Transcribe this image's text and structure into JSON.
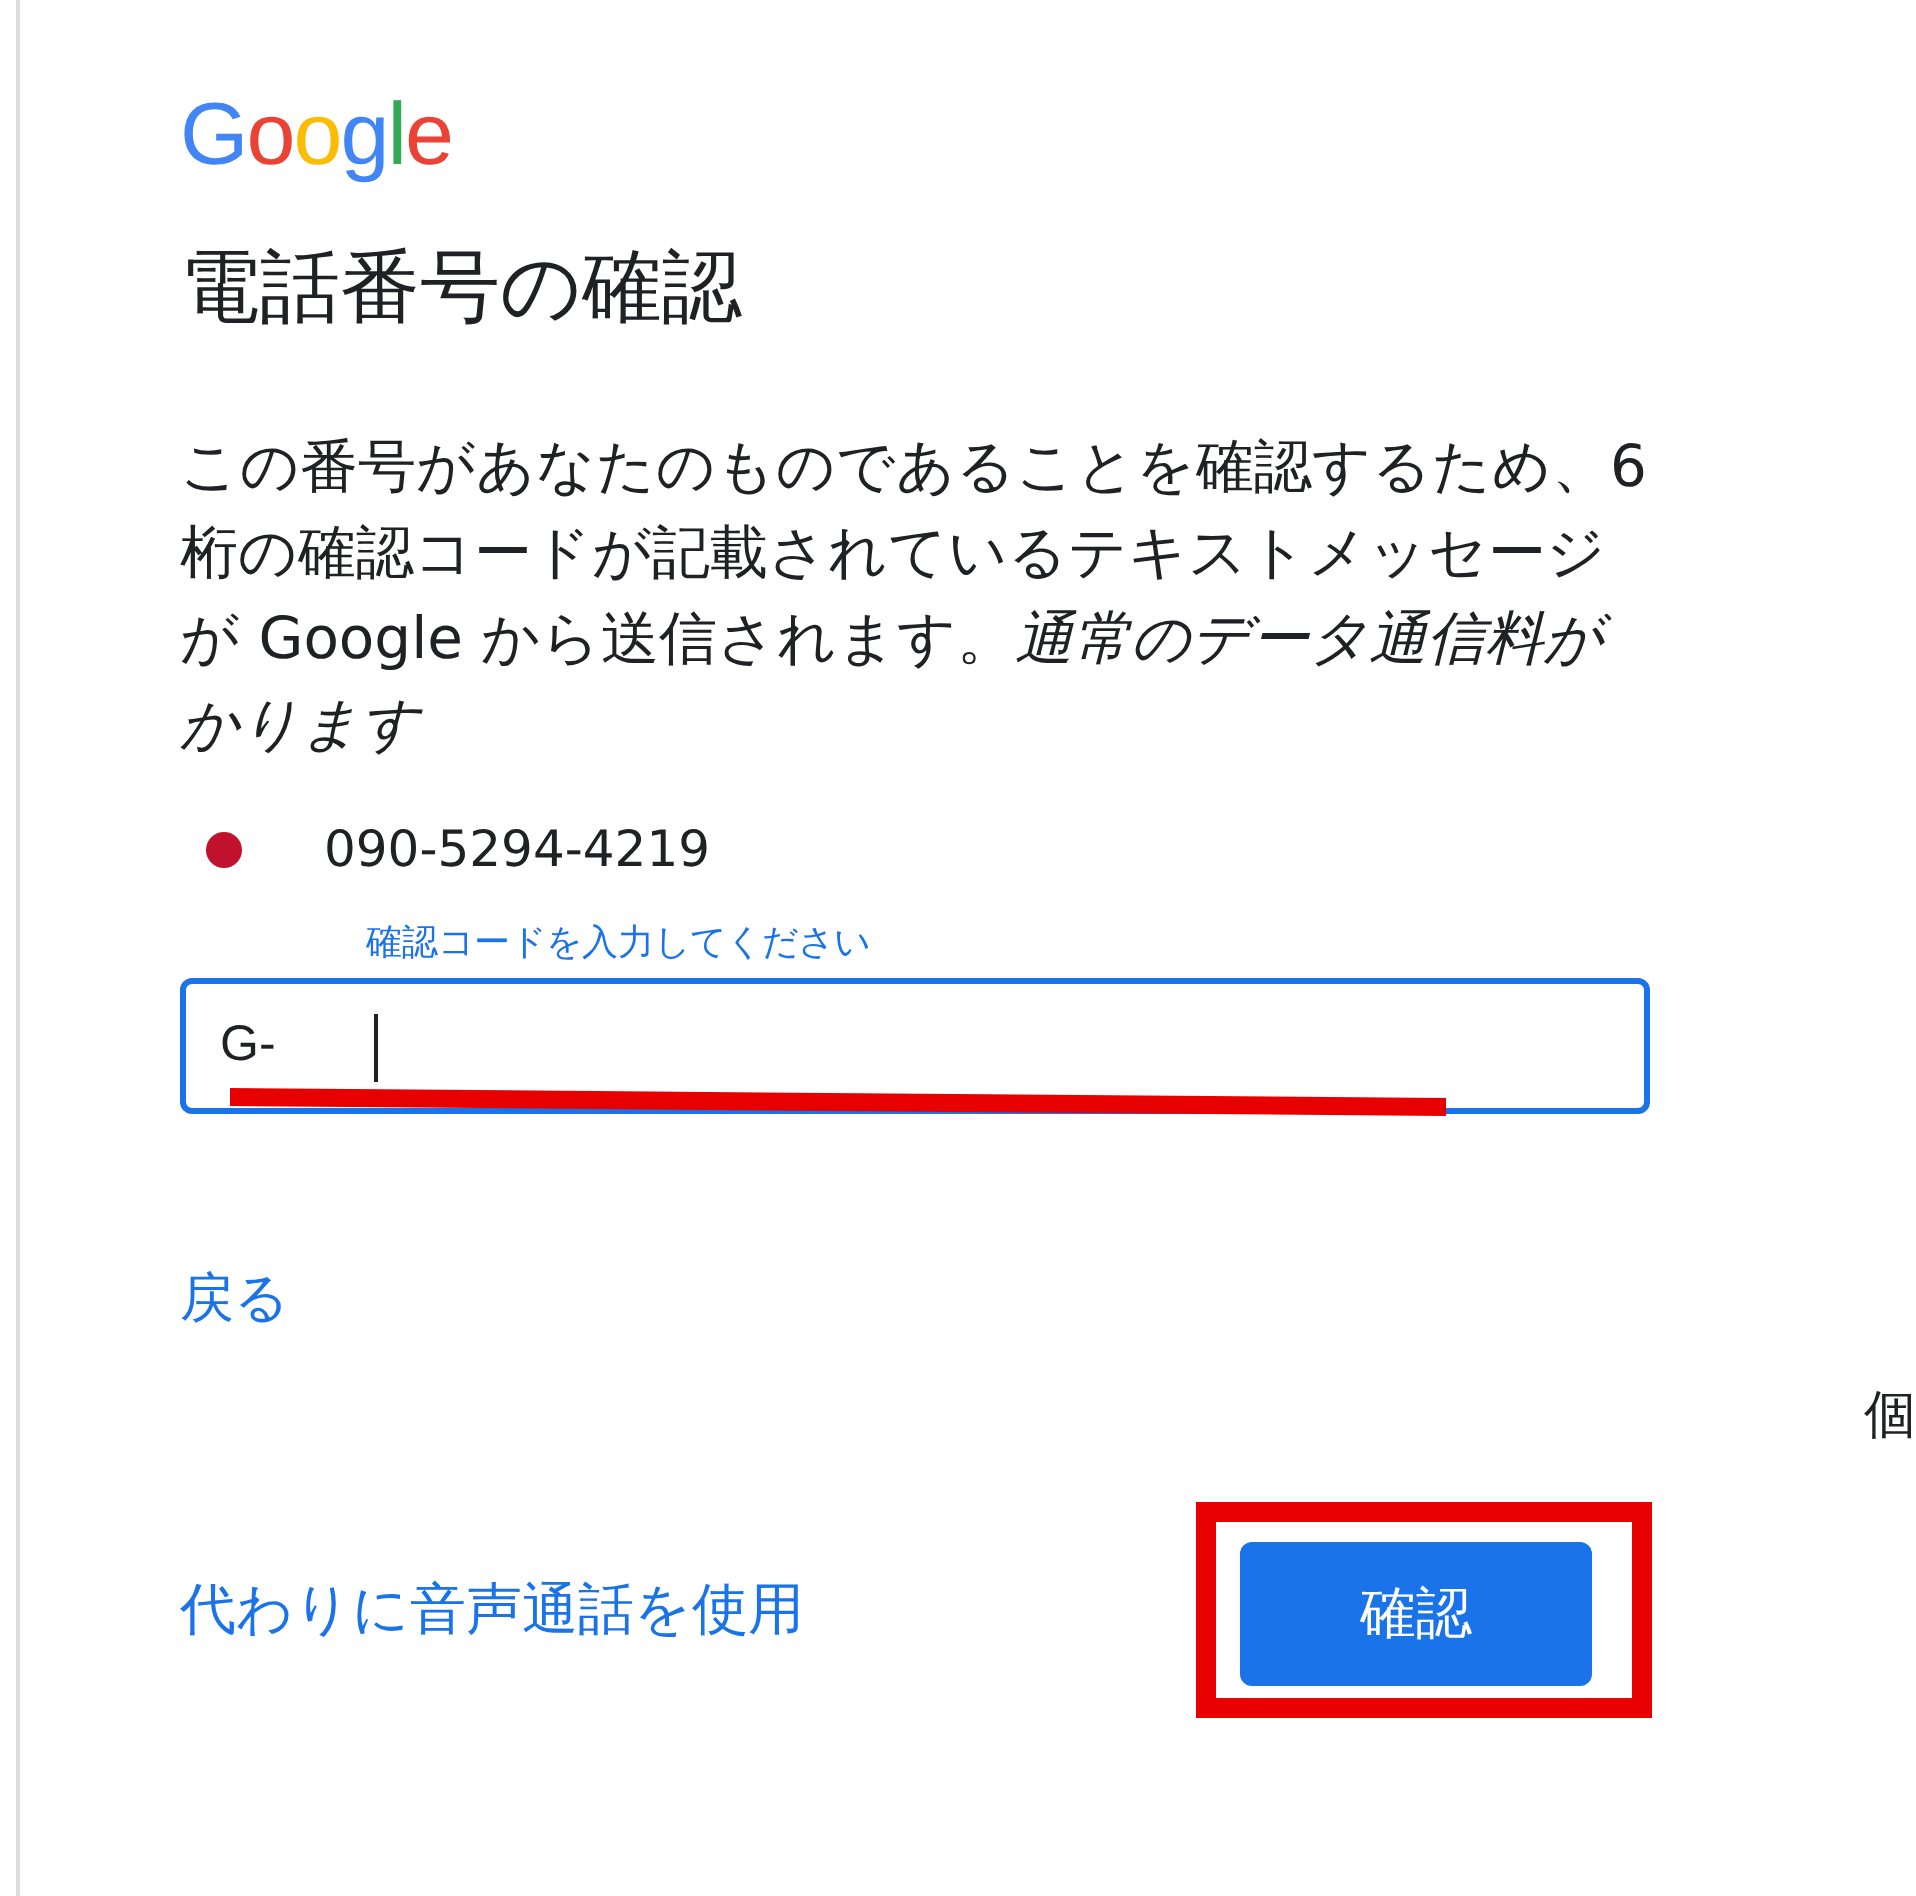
{
  "logo": "Google",
  "title": "電話番号の確認",
  "description": "この番号があなたのものであることを確認するため、6 桁の確認コードが記載されているテキストメッセージが Google から送信されます。*通常のデータ通信料がかります*",
  "phone": {
    "number": "090-5294-4219"
  },
  "code_field": {
    "label": "確認コードを入力してください",
    "value": "G-",
    "focused": true,
    "underline_mark": true
  },
  "back_link": "戻る",
  "voice_link": "代わりに音声通話を使用",
  "confirm_button": {
    "label": "確認",
    "highlight_frame": true
  },
  "side_text": "個"
}
